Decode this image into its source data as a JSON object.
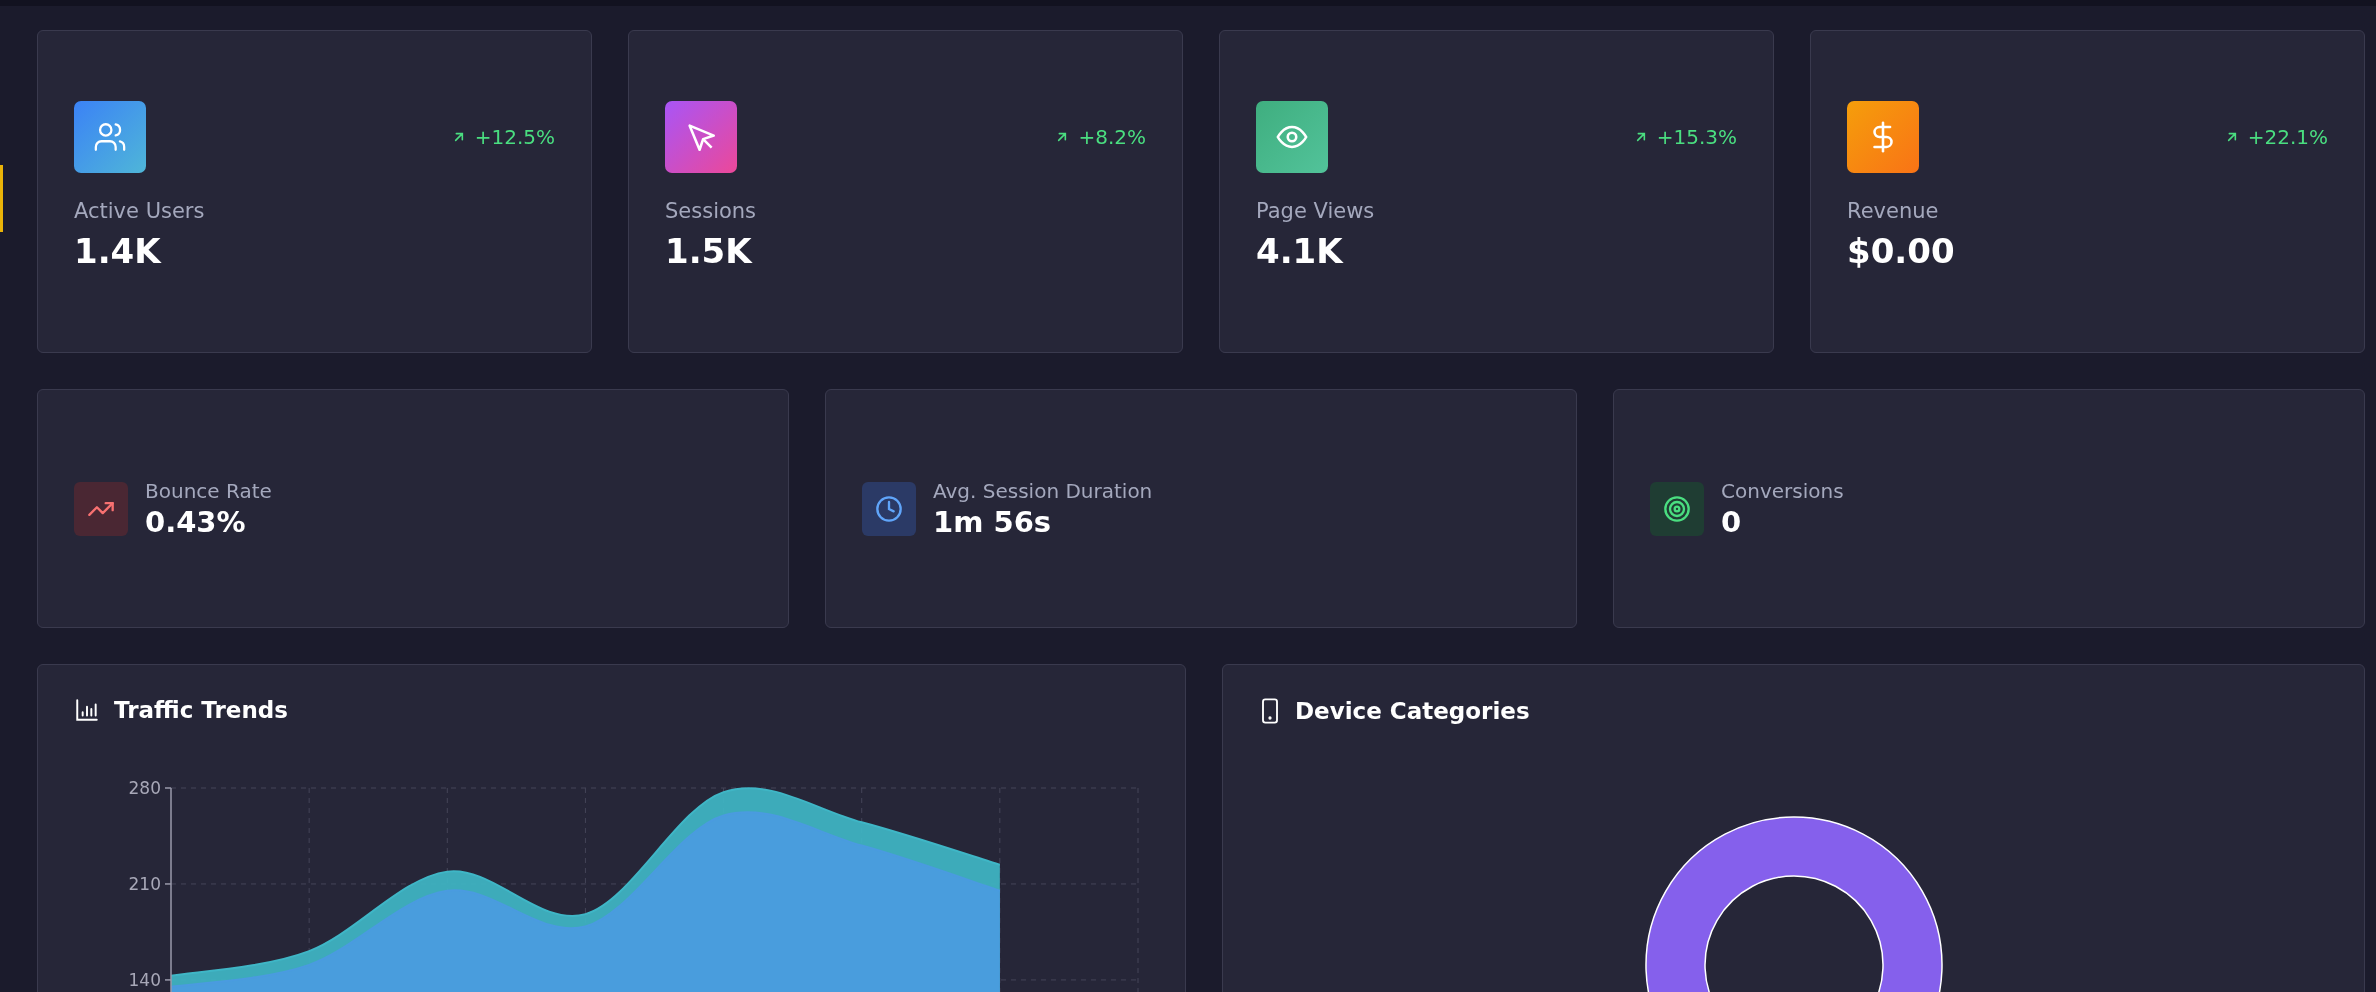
{
  "stat_cards": [
    {
      "kind": "users",
      "label": "Active Users",
      "value": "1.4K",
      "trend": "+12.5%"
    },
    {
      "kind": "cursor",
      "label": "Sessions",
      "value": "1.5K",
      "trend": "+8.2%"
    },
    {
      "kind": "eye",
      "label": "Page Views",
      "value": "4.1K",
      "trend": "+15.3%"
    },
    {
      "kind": "dollar",
      "label": "Revenue",
      "value": "$0.00",
      "trend": "+22.1%"
    }
  ],
  "metric_cards": [
    {
      "kind": "bounce",
      "label": "Bounce Rate",
      "value": "0.43%"
    },
    {
      "kind": "clock",
      "label": "Avg. Session Duration",
      "value": "1m 56s"
    },
    {
      "kind": "target",
      "label": "Conversions",
      "value": "0"
    }
  ],
  "traffic_trends": {
    "title": "Traffic Trends",
    "chart_data": {
      "type": "area",
      "categories": [
        null,
        null,
        null,
        null,
        null,
        null,
        null,
        null
      ],
      "ylim": [
        129,
        280
      ],
      "grid": true,
      "yticks": [
        140,
        210,
        280
      ],
      "series": [
        {
          "color": "#3fb6c6",
          "values": [
            143,
            161,
            219,
            188,
            277,
            255,
            224,
            null
          ]
        },
        {
          "color": "#4a9be0",
          "values": [
            135,
            151,
            205,
            179,
            260,
            238,
            205,
            null
          ]
        }
      ]
    }
  },
  "device_categories": {
    "title": "Device Categories"
  }
}
